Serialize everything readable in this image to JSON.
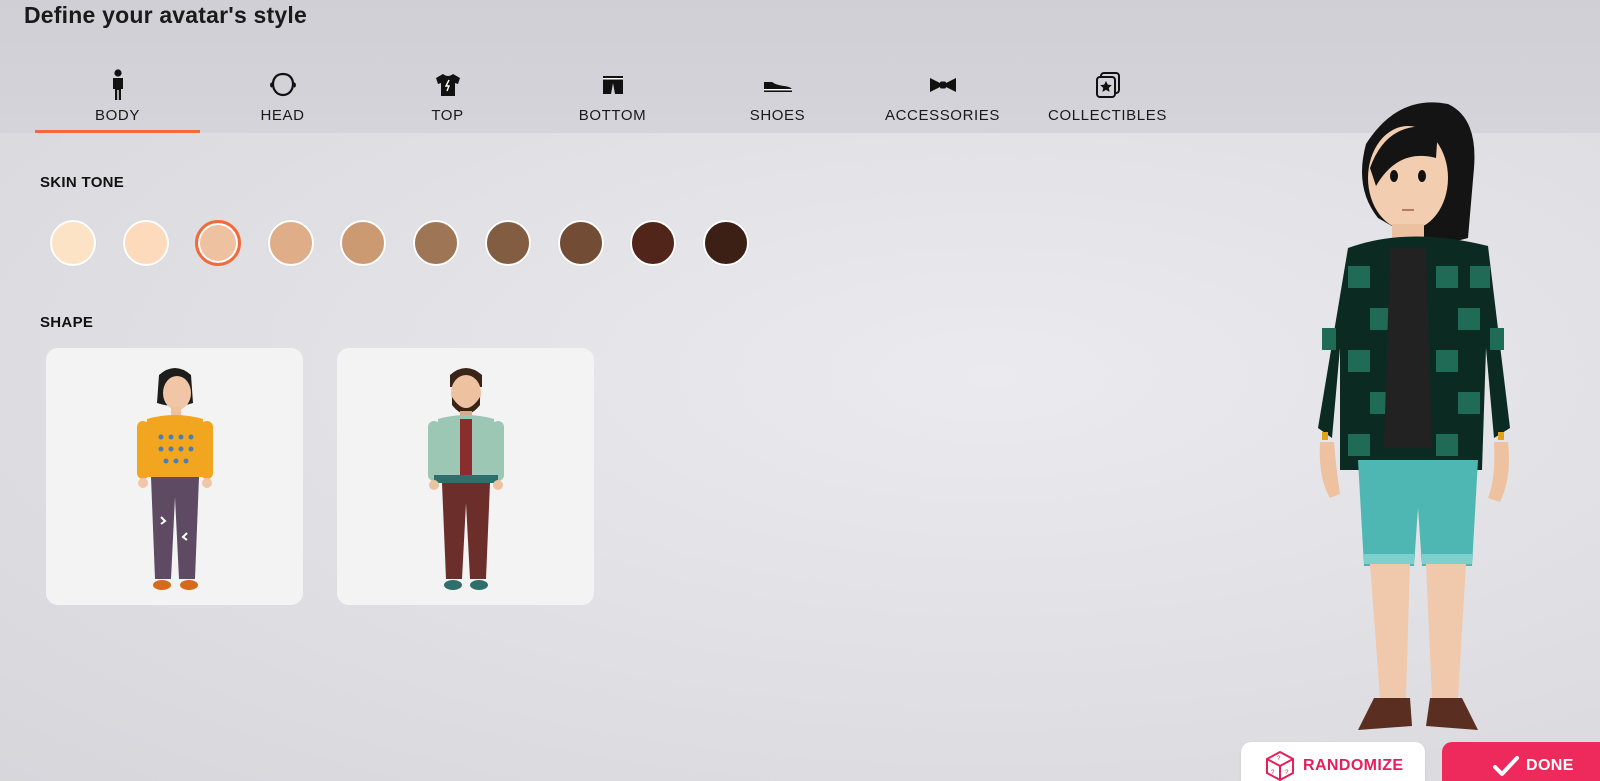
{
  "header": {
    "title": "Define your avatar's style"
  },
  "tabs": [
    {
      "label": "BODY",
      "icon": "person-icon",
      "active": true
    },
    {
      "label": "HEAD",
      "icon": "head-icon",
      "active": false
    },
    {
      "label": "TOP",
      "icon": "shirt-icon",
      "active": false
    },
    {
      "label": "BOTTOM",
      "icon": "shorts-icon",
      "active": false
    },
    {
      "label": "SHOES",
      "icon": "shoe-icon",
      "active": false
    },
    {
      "label": "ACCESSORIES",
      "icon": "bowtie-icon",
      "active": false
    },
    {
      "label": "COLLECTIBLES",
      "icon": "star-cards-icon",
      "active": false
    }
  ],
  "skin_tone": {
    "label": "SKIN TONE",
    "selected_index": 2,
    "colors": [
      "#fde3c6",
      "#fddabb",
      "#eec1a0",
      "#dfae88",
      "#cc9a72",
      "#9e7656",
      "#825d42",
      "#734c35",
      "#52251a",
      "#3c2015"
    ]
  },
  "shape": {
    "label": "SHAPE",
    "options": [
      {
        "name": "feminine-shape",
        "icon": "female-avatar-icon"
      },
      {
        "name": "masculine-shape",
        "icon": "male-avatar-icon"
      }
    ]
  },
  "actions": {
    "randomize_label": "RANDOMIZE",
    "done_label": "DONE"
  },
  "colors": {
    "accent": "#f26a3c",
    "primary_button": "#ee2a5c",
    "randomize_text": "#e3205a"
  }
}
